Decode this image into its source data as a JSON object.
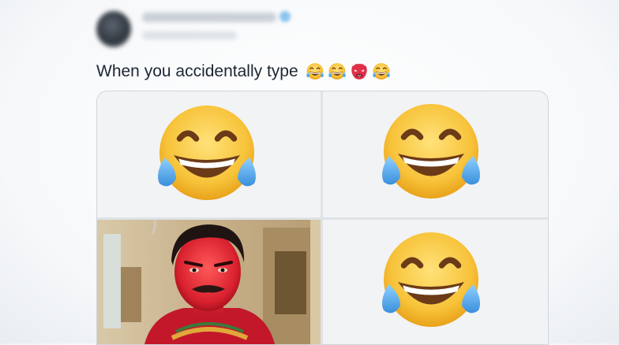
{
  "tweet": {
    "text": "When you accidentally type",
    "typed_emojis": [
      "face-with-tears-of-joy-icon",
      "face-with-tears-of-joy-icon",
      "angry-red-mask-icon",
      "face-with-tears-of-joy-icon"
    ]
  },
  "media": {
    "cells": [
      {
        "kind": "emoji",
        "icon": "face-with-tears-of-joy-icon"
      },
      {
        "kind": "emoji",
        "icon": "face-with-tears-of-joy-icon"
      },
      {
        "kind": "photo",
        "subject": "man-with-red-painted-face"
      },
      {
        "kind": "emoji",
        "icon": "face-with-tears-of-joy-icon"
      }
    ]
  },
  "colors": {
    "text": "#1c2733",
    "emoji_face": "#f7c33a",
    "emoji_tear": "#5aa9e8",
    "mask_red": "#e0304a"
  }
}
